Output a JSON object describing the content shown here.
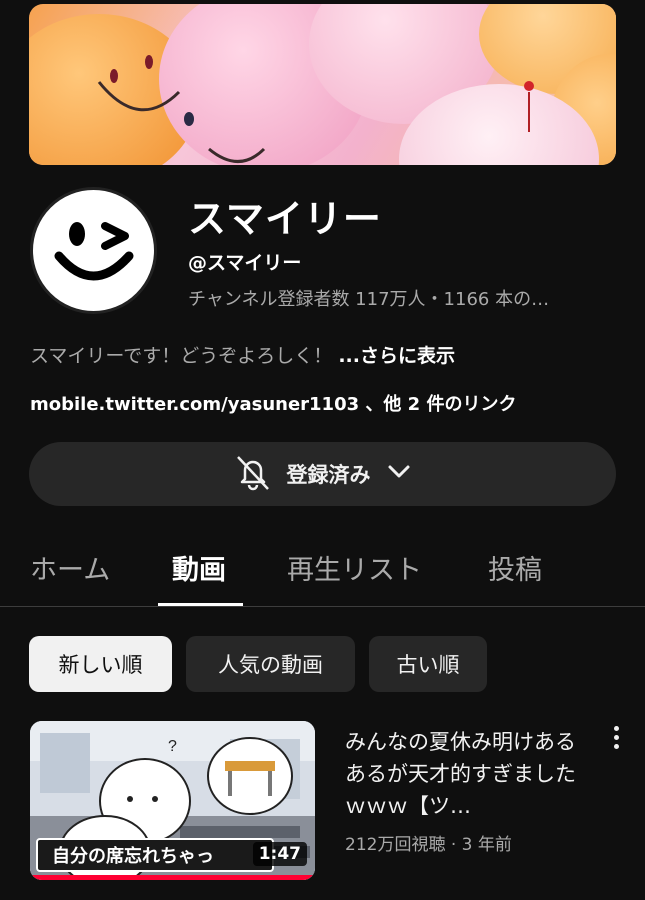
{
  "channel": {
    "name": "スマイリー",
    "handle": "@スマイリー",
    "stats": "チャンネル登録者数 117万人・1166 本の…",
    "description": "スマイリーです！どうぞよろしく！",
    "description_more": "...さらに表示",
    "links": "mobile.twitter.com/yasuner1103 、他 2 件のリンク"
  },
  "subscribe": {
    "label": "登録済み",
    "bell_icon": "bell-off-icon",
    "dropdown_icon": "chevron-down-icon"
  },
  "tabs": [
    {
      "label": "ホーム",
      "active": false
    },
    {
      "label": "動画",
      "active": true
    },
    {
      "label": "再生リスト",
      "active": false
    },
    {
      "label": "投稿",
      "active": false
    }
  ],
  "filters": [
    {
      "label": "新しい順",
      "active": true
    },
    {
      "label": "人気の動画",
      "active": false
    },
    {
      "label": "古い順",
      "active": false
    }
  ],
  "videos": [
    {
      "title": "みんなの夏休み明けあるあるが天才的すぎましたｗｗｗ【ツ…",
      "meta": "212万回視聴 · 3 年前",
      "duration": "1:47",
      "thumbnail_caption": "自分の席忘れちゃっ",
      "watched_fraction": 1.0
    }
  ],
  "colors": {
    "background": "#0f0f0f",
    "button_bg": "#272727",
    "progress": "#ff0033"
  }
}
